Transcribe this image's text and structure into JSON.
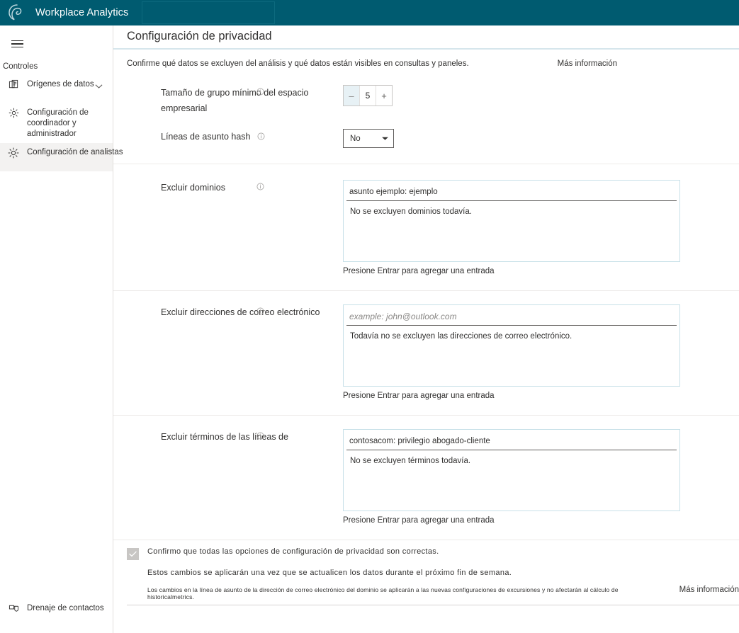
{
  "header": {
    "app_title": "Workplace Analytics",
    "logo_icon": "workplace-analytics-logo",
    "search_placeholder": ""
  },
  "sidebar": {
    "menu_icon": "hamburger-menu-icon",
    "group_label": "Controles",
    "items": [
      {
        "label": "Orígenes de datos",
        "icon": "data-sources-icon",
        "has_chevron": true,
        "selected": false
      },
      {
        "label": "Configuración de coordinador y administrador",
        "icon": "gear-icon",
        "has_chevron": false,
        "selected": false
      },
      {
        "label": "Configuración de analistas",
        "icon": "gear-icon",
        "has_chevron": false,
        "selected": true
      }
    ],
    "bottom_item": {
      "label": "Drenaje de contactos",
      "icon": "contact-drain-icon"
    }
  },
  "main": {
    "page_title": "Configuración de privacidad",
    "intro_text": "Confirme qué datos se excluyen del análisis y qué datos están visibles en consultas y paneles.",
    "intro_link": "Más información",
    "group_size": {
      "label": "Tamaño de grupo mínimo del espacio empresarial",
      "info_icon": "info-icon",
      "minus_label": "–",
      "value": "5",
      "plus_label": "+"
    },
    "hash_subject": {
      "label": "Líneas de asunto hash",
      "info_icon": "info-icon",
      "value": "No",
      "chevron_icon": "chevron-down-icon"
    },
    "exclude_domains": {
      "label": "Excluir dominios",
      "info_icon": "info-icon",
      "input_value": "asunto ejemplo: ejemplo",
      "empty_text": "No se excluyen dominios todavía.",
      "hint": "Presione Entrar para agregar una entrada"
    },
    "exclude_emails": {
      "label": "Excluir direcciones de correo electrónico",
      "info_icon": "info-icon",
      "input_placeholder": "example: john@outlook.com",
      "empty_text": "Todavía no se excluyen las direcciones de correo electrónico.",
      "hint": "Presione Entrar para agregar una entrada"
    },
    "exclude_terms": {
      "label": "Excluir términos de las líneas de",
      "info_icon": "info-icon",
      "input_value": "contosacom: privilegio abogado-cliente",
      "empty_text": "No se excluyen términos todavía.",
      "hint": "Presione Entrar para agregar una entrada"
    },
    "confirm": {
      "checkbox_icon": "checkmark-icon",
      "checkbox_checked": "true",
      "text": "Confirmo que todas las opciones de configuración de privacidad son correctas.",
      "note": "Estos cambios se aplicarán una vez que se actualicen los datos durante el próximo fin de semana.",
      "fine_print": "Los cambios en la línea de asunto de la dirección de correo electrónico del dominio se aplicarán a las nuevas configuraciones de excursiones y no afectarán al cálculo de historicalmetrics.",
      "more_link": "Más información"
    }
  },
  "colors": {
    "brand_teal": "#005b70",
    "title_rule": "#d6e6ec",
    "entry_border": "#c7e0e8",
    "selected_nav": "#f3f2f1"
  }
}
